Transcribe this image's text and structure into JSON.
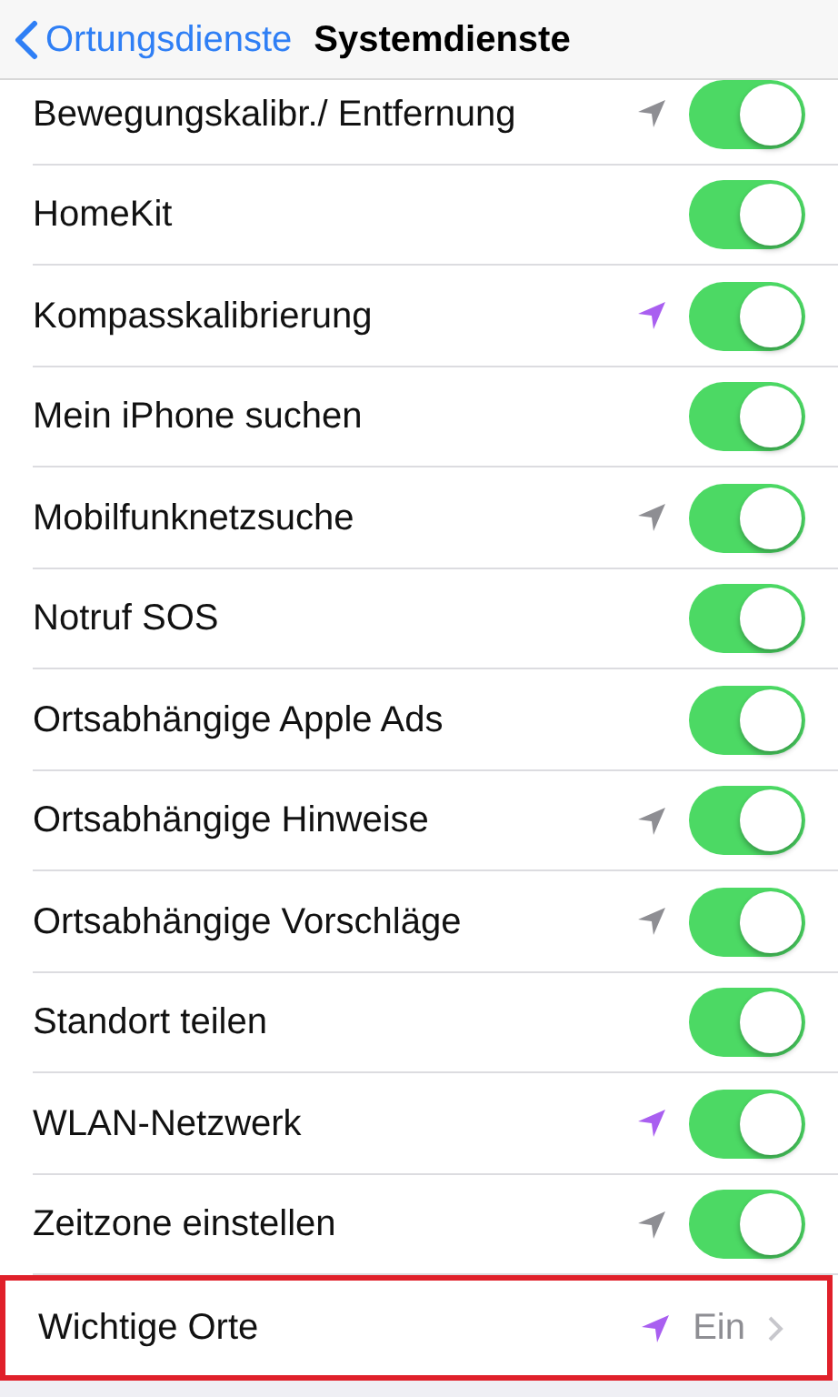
{
  "nav": {
    "back": "Ortungsdienste",
    "title": "Systemdienste"
  },
  "rows": [
    {
      "kind": "toggle",
      "label": "Bewegungskalibr./ Entfernung",
      "color": "#8e8e93",
      "on": true
    },
    {
      "kind": "toggle",
      "label": "HomeKit",
      "on": true
    },
    {
      "kind": "toggle",
      "label": "Kompasskalibrierung",
      "color": "#a95ff0",
      "on": true
    },
    {
      "kind": "toggle",
      "label": "Mein iPhone suchen",
      "on": true
    },
    {
      "kind": "toggle",
      "label": "Mobilfunknetzsuche",
      "color": "#8e8e93",
      "on": true
    },
    {
      "kind": "toggle",
      "label": "Notruf SOS",
      "on": true
    },
    {
      "kind": "toggle",
      "label": "Ortsabhängige Apple Ads",
      "on": true
    },
    {
      "kind": "toggle",
      "label": "Ortsabhängige Hinweise",
      "color": "#8e8e93",
      "on": true
    },
    {
      "kind": "toggle",
      "label": "Ortsabhängige Vorschläge",
      "color": "#8e8e93",
      "on": true
    },
    {
      "kind": "toggle",
      "label": "Standort teilen",
      "on": true
    },
    {
      "kind": "toggle",
      "label": "WLAN-Netzwerk",
      "color": "#a95ff0",
      "on": true
    },
    {
      "kind": "toggle",
      "label": "Zeitzone einstellen",
      "color": "#8e8e93",
      "on": true
    },
    {
      "kind": "disclosure",
      "label": "Wichtige Orte",
      "color": "#a95ff0",
      "value": "Ein",
      "highlighted": true
    }
  ]
}
